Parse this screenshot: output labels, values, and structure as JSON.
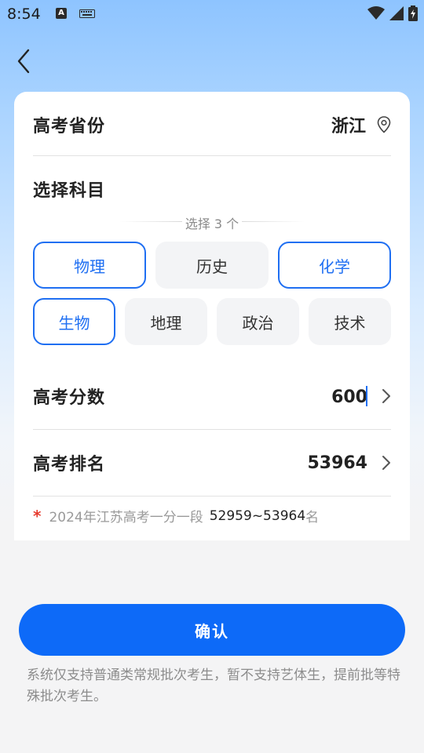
{
  "status_bar": {
    "time": "8:54",
    "a_badge": "A"
  },
  "province": {
    "label": "高考省份",
    "value": "浙江"
  },
  "subjects": {
    "label": "选择科目",
    "hint": "选择 3 个",
    "items": [
      {
        "name": "物理",
        "selected": true
      },
      {
        "name": "历史",
        "selected": false
      },
      {
        "name": "化学",
        "selected": true
      },
      {
        "name": "生物",
        "selected": true
      },
      {
        "name": "地理",
        "selected": false
      },
      {
        "name": "政治",
        "selected": false
      },
      {
        "name": "技术",
        "selected": false
      }
    ]
  },
  "score": {
    "label": "高考分数",
    "value": "600"
  },
  "rank": {
    "label": "高考排名",
    "value": "53964"
  },
  "note": {
    "star": "*",
    "text": "2024年江苏高考一分一段",
    "range": "52959~53964",
    "suffix": "名"
  },
  "confirm_label": "确认",
  "footnote": "系统仅支持普通类常规批次考生，暂不支持艺体生，提前批等特殊批次考生。",
  "colors": {
    "accent": "#0d6af8",
    "chip_border": "#1f6ff2",
    "star": "#e63b2e"
  }
}
